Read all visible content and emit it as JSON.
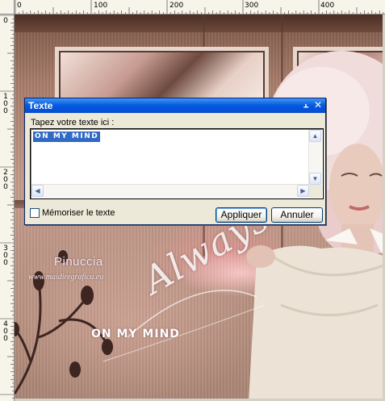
{
  "ruler": {
    "top_labels": [
      "0",
      "100",
      "200",
      "300",
      "400"
    ],
    "left_labels": [
      "0",
      "100",
      "200",
      "300",
      "400"
    ]
  },
  "artwork": {
    "watermark_name": "Pinuccia",
    "watermark_url": "www.maidiregrafica.eu",
    "script_text": "Always",
    "mind_text": "ON MY MIND"
  },
  "dialog": {
    "title": "Texte",
    "pin_icon": "pin-icon",
    "close_icon": "close-icon",
    "prompt_label": "Tapez votre texte ici :",
    "text_value": "ON MY MIND",
    "remember_label": "Mémoriser le texte",
    "remember_checked": false,
    "apply_label": "Appliquer",
    "cancel_label": "Annuler"
  },
  "colors": {
    "title_bar": "#0054e3",
    "selection": "#316ac5",
    "dialog_bg": "#ece9d8"
  }
}
